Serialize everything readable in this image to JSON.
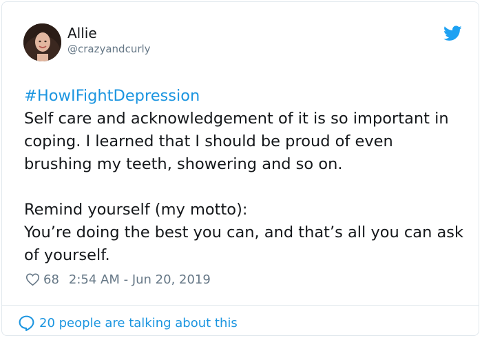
{
  "tweet": {
    "author_name": "Allie",
    "author_handle": "@crazyandcurly",
    "hashtag": "#HowIFightDepression",
    "paragraph_1": "Self care and acknowledgement of it is so important in coping. I learned that I should be proud of even brushing my teeth, showering and so on.",
    "paragraph_2_line_1": "Remind yourself (my motto):",
    "paragraph_2_line_2": "You’re doing the best you can, and that’s all you can ask of yourself.",
    "like_count": "68",
    "timestamp": "2:54 AM - Jun 20, 2019",
    "conversation_text": "20 people are talking about this"
  },
  "icons": {
    "brand": "twitter-bird-icon",
    "like": "heart-icon",
    "conversation": "speech-bubble-icon"
  },
  "colors": {
    "accent": "#1b95e0",
    "text": "#14171a",
    "secondary_text": "#657786",
    "border": "#e1e8ed"
  }
}
